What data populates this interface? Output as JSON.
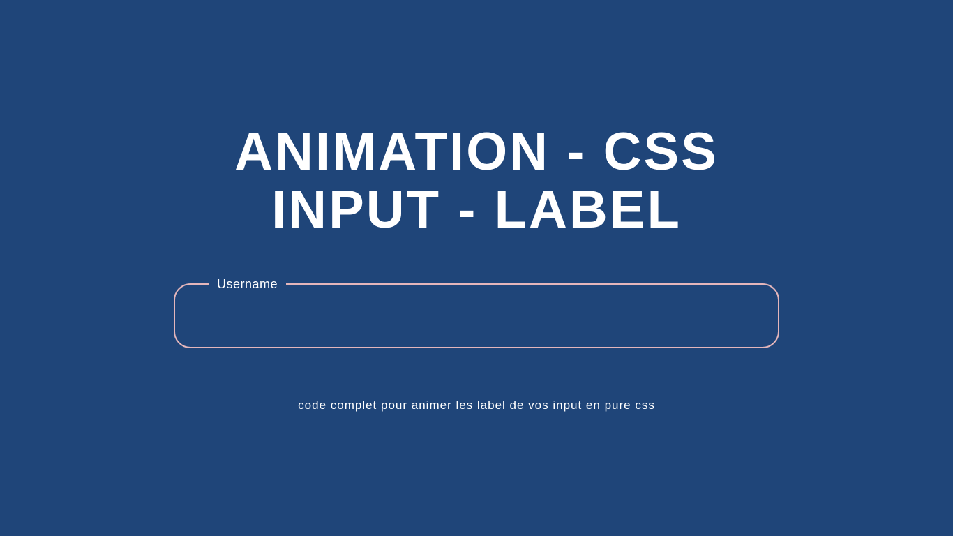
{
  "colors": {
    "background": "#1f4579",
    "text": "#ffffff",
    "border": "#e4b6bb"
  },
  "header": {
    "title_line1": "ANIMATION - CSS",
    "title_line2": "INPUT - LABEL"
  },
  "form": {
    "username": {
      "label": "Username",
      "value": ""
    }
  },
  "footer": {
    "description": "code complet pour animer les label de vos input en pure css"
  }
}
